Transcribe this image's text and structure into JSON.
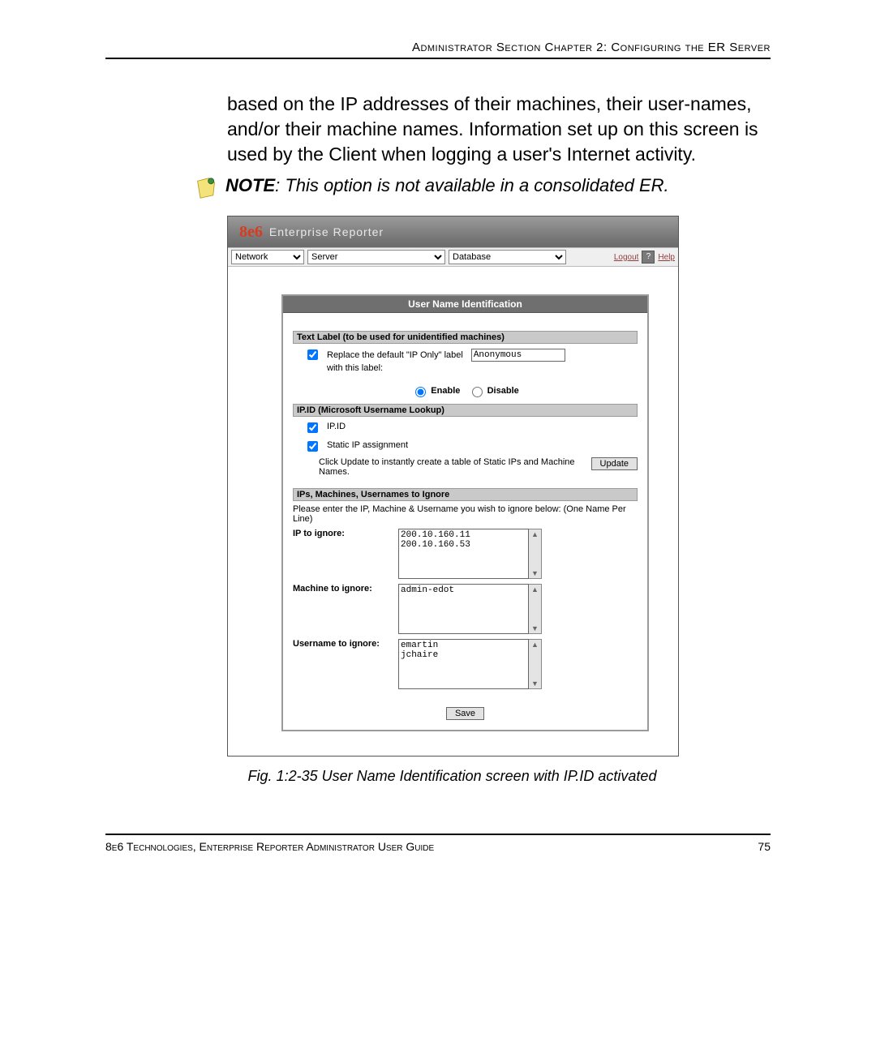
{
  "header": "Administrator Section  Chapter 2: Configuring the ER Server",
  "para": "based on the IP addresses of their machines, their user-names, and/or their machine names. Information set up on this screen is used by the Client when logging a user's Internet activity.",
  "note_label": "NOTE",
  "note_text": ": This option is not available in a consolidated ER.",
  "app": {
    "brand": "8e6",
    "brand_sub": "Enterprise Reporter",
    "menu": {
      "network": "Network",
      "server": "Server",
      "database": "Database",
      "logout": "Logout",
      "help": "Help"
    },
    "panel_title": "User Name Identification",
    "sec1": {
      "head": "Text Label (to be used for unidentified machines)",
      "cb_label_a": "Replace the default \"IP Only\" label",
      "cb_label_b": "with this label:",
      "value": "Anonymous"
    },
    "radio": {
      "enable": "Enable",
      "disable": "Disable"
    },
    "sec2": {
      "head": "IP.ID (Microsoft Username Lookup)",
      "cb1": "IP.ID",
      "cb2": "Static IP assignment",
      "hint": "Click Update to instantly create a table of Static IPs and Machine Names.",
      "update": "Update"
    },
    "sec3": {
      "head": "IPs, Machines, Usernames to Ignore",
      "hint": "Please enter the IP, Machine & Username you wish to ignore below: (One Name Per Line)",
      "ip_label": "IP to ignore:",
      "ip_val": "200.10.160.11\n200.10.160.53",
      "mach_label": "Machine to ignore:",
      "mach_val": "admin-edot",
      "user_label": "Username to ignore:",
      "user_val": "emartin\njchaire"
    },
    "save": "Save"
  },
  "caption": "Fig. 1:2-35  User Name Identification screen with IP.ID activated",
  "footer_left": "8e6 Technologies, Enterprise Reporter Administrator User Guide",
  "footer_right": "75"
}
